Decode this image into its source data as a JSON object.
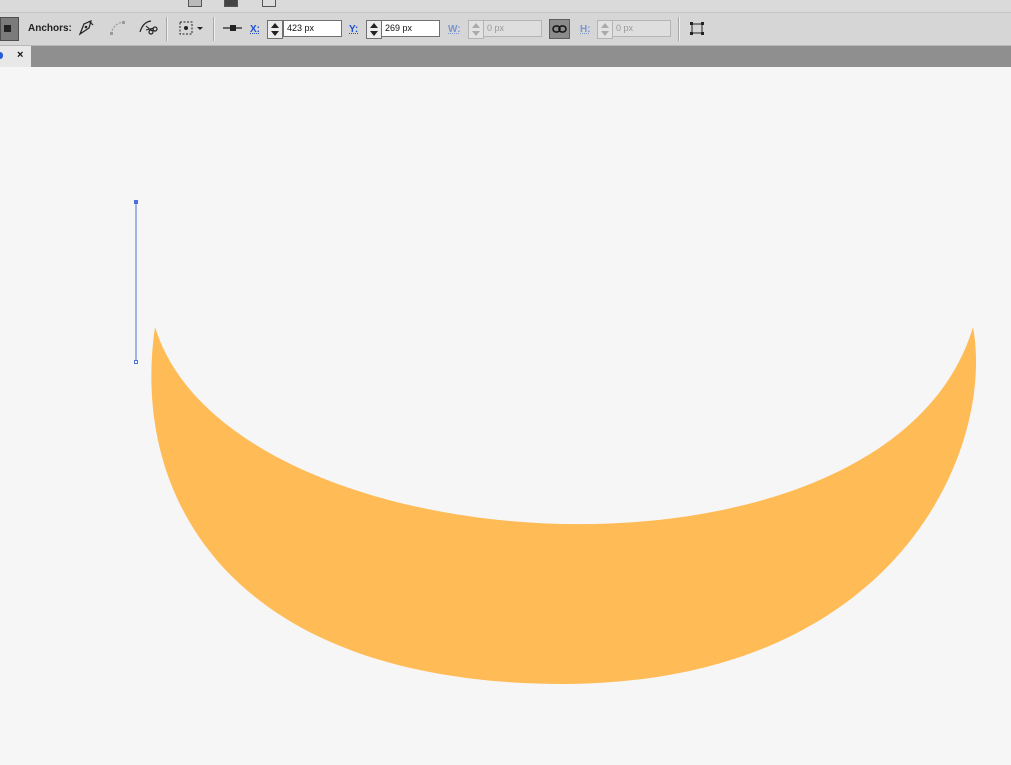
{
  "control_bar": {
    "anchors_label": "Anchors:",
    "x_label": "X:",
    "x_value": "423 px",
    "y_label": "Y:",
    "y_value": "269 px",
    "w_label": "W:",
    "w_value": "0 px",
    "h_label": "H:",
    "h_value": "0 px"
  },
  "document_tab": {
    "close_glyph": "×"
  },
  "icons": {
    "convert_anchor": "pen-icon",
    "handles": "handles-icon",
    "cut_path": "scissors-icon",
    "transform": "transform-icon",
    "align": "align-icon",
    "link": "link-icon",
    "bounding_box": "bounding-box-icon"
  },
  "colors": {
    "shape_fill": "#ffbb55",
    "selection": "#4a72d8",
    "canvas": "#f6f6f6"
  }
}
